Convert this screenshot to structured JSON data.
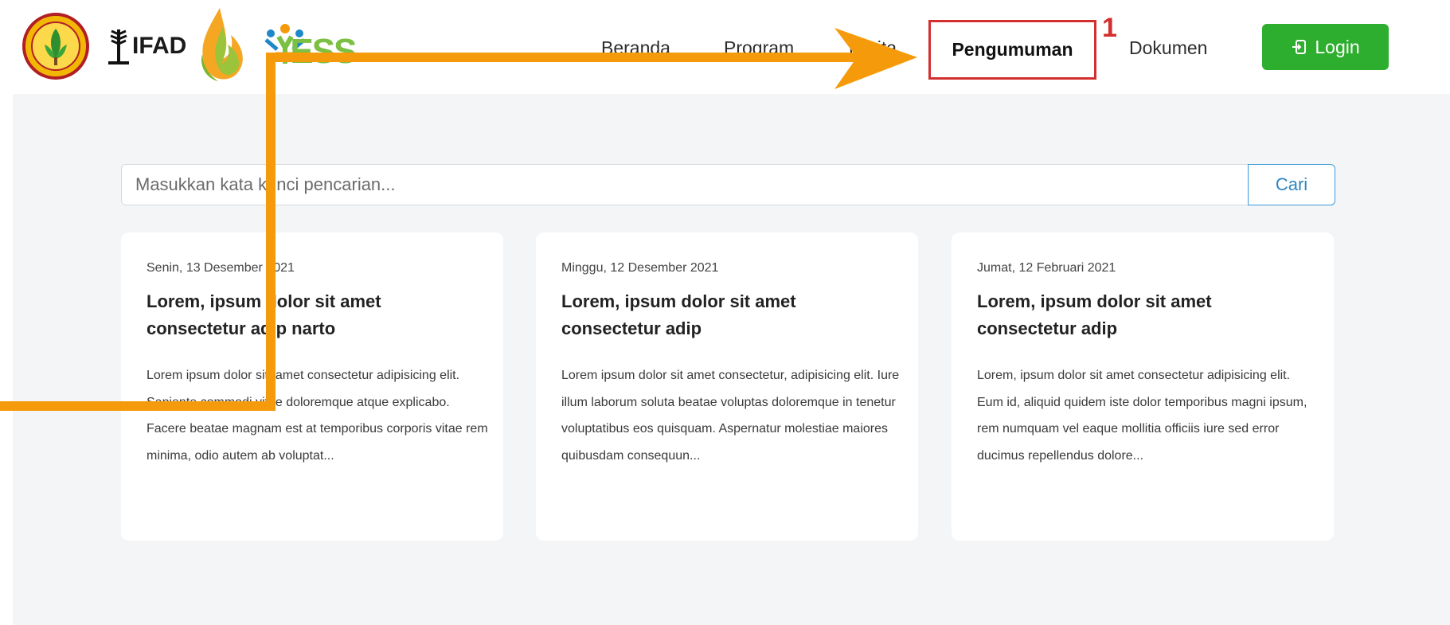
{
  "header": {
    "logos": {
      "ifad_text": "IFAD",
      "yess_text": "ESS"
    },
    "nav": {
      "items": [
        {
          "label": "Beranda"
        },
        {
          "label": "Program"
        },
        {
          "label": "Berita"
        },
        {
          "label": "Pengumuman",
          "active": true
        },
        {
          "label": "Dokumen"
        }
      ]
    },
    "login_label": "Login",
    "login_icon": "login-icon",
    "colors": {
      "login_bg": "#2eae2e",
      "highlight": "#d32f2f"
    }
  },
  "annotation": {
    "step_number": "1",
    "arrow_color": "#f59b0b"
  },
  "search": {
    "placeholder": "Masukkan kata kunci pencarian...",
    "button_label": "Cari"
  },
  "cards": [
    {
      "date": "Senin, 13 Desember 2021",
      "title": "Lorem, ipsum dolor sit amet consectetur adip narto",
      "excerpt": "Lorem ipsum dolor sit, amet consectetur adipisicing elit. Sapiente commodi vitae doloremque atque explicabo. Facere beatae magnam est at temporibus corporis vitae rem minima, odio autem ab voluptat..."
    },
    {
      "date": "Minggu, 12 Desember 2021",
      "title": "Lorem, ipsum dolor sit amet consectetur adip",
      "excerpt": "Lorem ipsum dolor sit amet consectetur, adipisicing elit. Iure illum laborum soluta beatae voluptas doloremque in tenetur voluptatibus eos quisquam. Aspernatur molestiae maiores quibusdam consequun..."
    },
    {
      "date": "Jumat, 12 Februari 2021",
      "title": "Lorem, ipsum dolor sit amet consectetur adip",
      "excerpt": "Lorem, ipsum dolor sit amet consectetur adipisicing elit. Eum id, aliquid quidem iste dolor temporibus magni ipsum, rem numquam vel eaque mollitia officiis iure sed error ducimus repellendus dolore..."
    }
  ]
}
